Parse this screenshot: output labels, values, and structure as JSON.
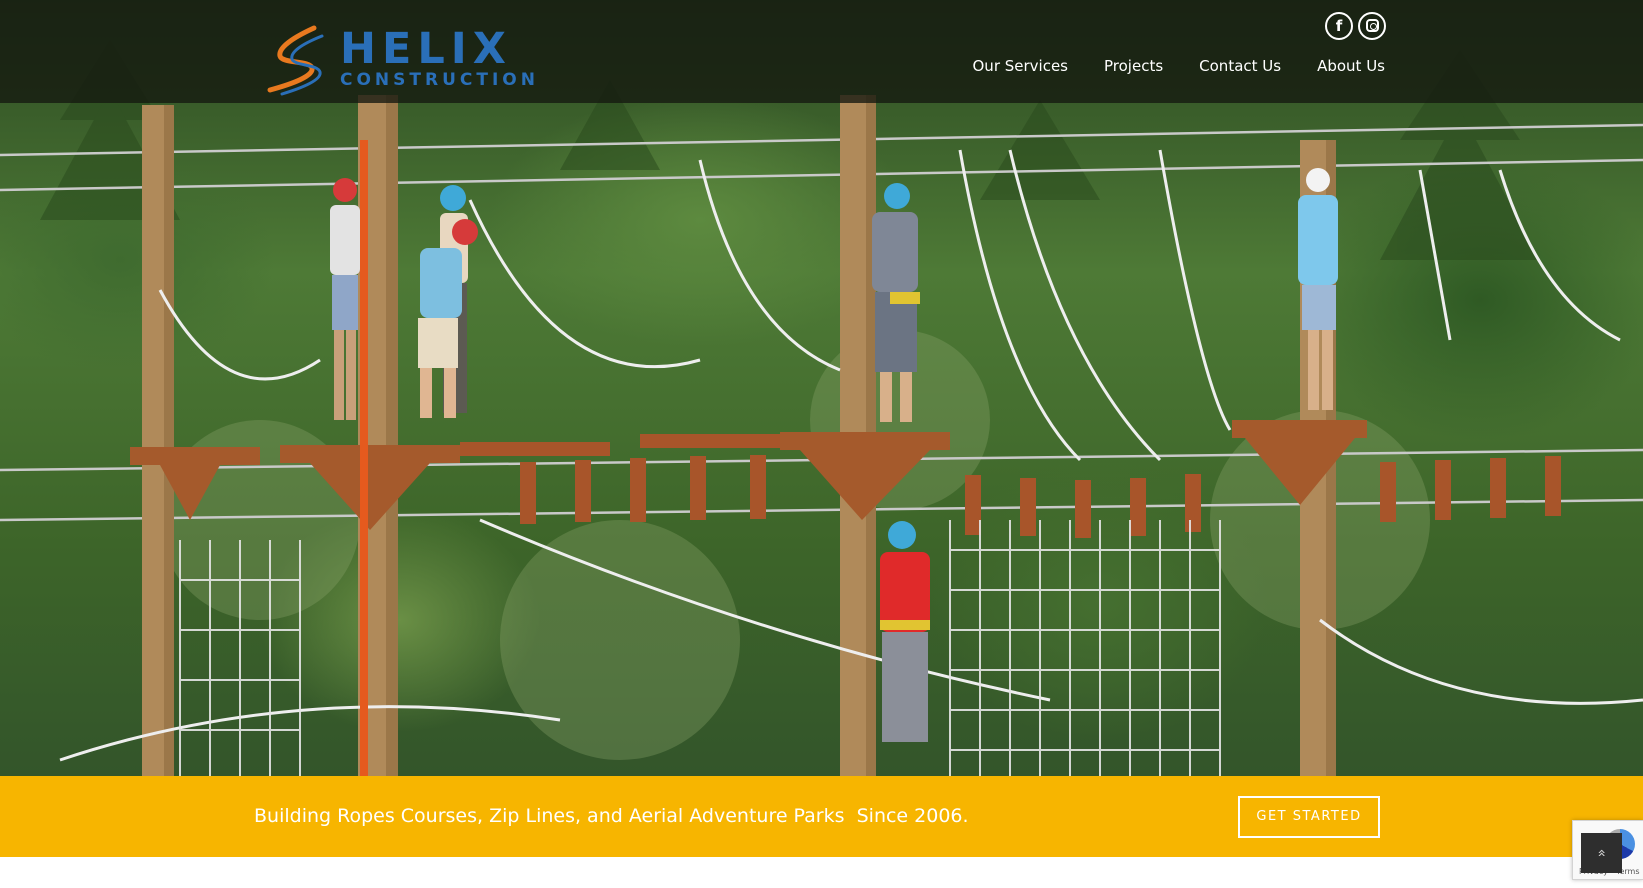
{
  "header": {
    "logo": {
      "name": "HELIX",
      "tagline": "CONSTRUCTION",
      "mark_colors": [
        "#e8791f",
        "#2a6fb8"
      ]
    },
    "social": [
      {
        "icon": "facebook-icon",
        "glyph": "f"
      },
      {
        "icon": "instagram-icon"
      }
    ],
    "nav": [
      {
        "label": "Our Services"
      },
      {
        "label": "Projects"
      },
      {
        "label": "Contact Us"
      },
      {
        "label": "About Us"
      }
    ]
  },
  "hero": {
    "image_subject": "ropes course"
  },
  "cta": {
    "text": "Building Ropes Courses, Zip Lines, and Aerial Adventure Parks  Since 2006.",
    "button_label": "GET STARTED",
    "background_color": "#f7b500"
  },
  "recaptcha": {
    "links": "Privacy - Terms"
  },
  "scroll_top": {
    "icon": "chevron-up-icon",
    "glyph": "«"
  }
}
